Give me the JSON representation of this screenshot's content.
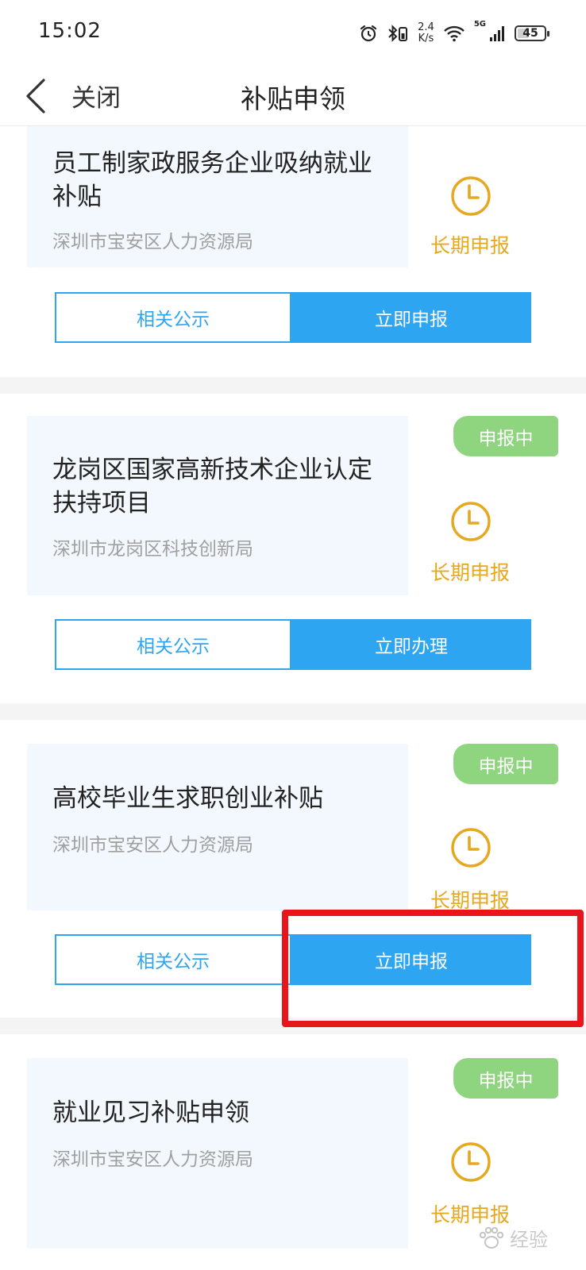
{
  "status_bar": {
    "time": "15:02",
    "net_speed_value": "2.4",
    "net_speed_unit": "K/s",
    "network_type": "5G",
    "battery": "45",
    "battery_fraction": 0.45
  },
  "nav": {
    "close_label": "关闭",
    "title": "补贴申领"
  },
  "cards": [
    {
      "title": "员工制家政服务企业吸纳就业补贴",
      "org": "深圳市宝安区人力资源局",
      "status": "",
      "period": "长期申报",
      "notice_label": "相关公示",
      "action_label": "立即申报"
    },
    {
      "title": "龙岗区国家高新技术企业认定扶持项目",
      "org": "深圳市龙岗区科技创新局",
      "status": "申报中",
      "period": "长期申报",
      "notice_label": "相关公示",
      "action_label": "立即办理"
    },
    {
      "title": "高校毕业生求职创业补贴",
      "org": "深圳市宝安区人力资源局",
      "status": "申报中",
      "period": "长期申报",
      "notice_label": "相关公示",
      "action_label": "立即申报"
    },
    {
      "title": "就业见习补贴申领",
      "org": "深圳市宝安区人力资源局",
      "status": "申报中",
      "period": "长期申报",
      "notice_label": "",
      "action_label": ""
    }
  ],
  "watermark": "经验",
  "colors": {
    "primary_blue": "#2ea5f0",
    "status_green": "#8fd47f",
    "period_orange": "#e6a81e",
    "highlight_red": "#e8161b"
  }
}
